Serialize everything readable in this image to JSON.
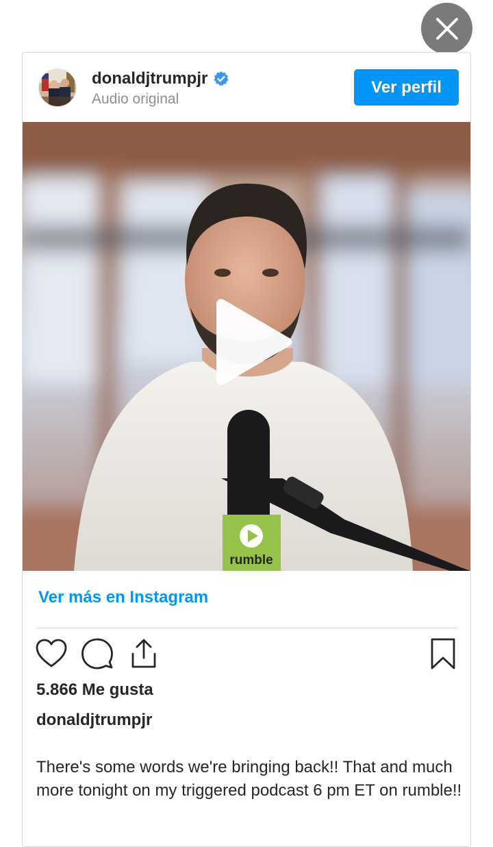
{
  "post": {
    "username": "donaldjtrumpjr",
    "audio": "Audio original",
    "profile_button": "Ver perfil",
    "see_more": "Ver más en Instagram",
    "likes": "5.866 Me gusta",
    "caption_user": "donaldjtrumpjr",
    "caption": "There's some words we're bringing back!! That and much more tonight on my triggered podcast 6 pm ET on rumble!!",
    "verified": true
  },
  "media": {
    "mic_logo_text": "rumble"
  },
  "icons": {
    "close": "close-icon",
    "verified": "verified-badge-icon",
    "play": "play-icon",
    "like": "heart-icon",
    "comment": "comment-icon",
    "share": "share-icon",
    "save": "bookmark-icon"
  },
  "colors": {
    "accent": "#0095f6",
    "text": "#262626",
    "muted": "#8e8e8e"
  }
}
